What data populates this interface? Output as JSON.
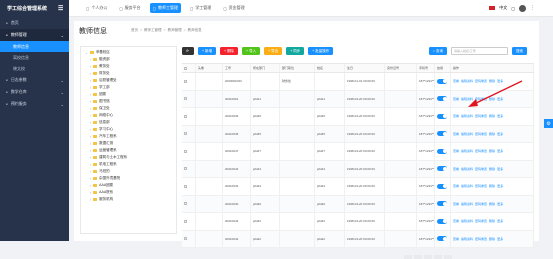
{
  "app": {
    "title": "学工综合管理系统"
  },
  "sidebar": {
    "items": [
      {
        "label": "首页",
        "icon": "home-icon"
      },
      {
        "label": "教师管理",
        "icon": "users-icon",
        "expanded": true
      },
      {
        "label": "教师信息",
        "sub": true,
        "selected": true
      },
      {
        "label": "离校信息",
        "sub": true
      },
      {
        "label": "晓太校",
        "sub": true
      },
      {
        "label": "日志参数",
        "icon": "calendar-icon"
      },
      {
        "label": "数学仓库",
        "icon": "book-icon"
      },
      {
        "label": "预约服务",
        "icon": "service-icon"
      }
    ]
  },
  "topbar": {
    "tabs": [
      {
        "label": "个人办公",
        "icon": "user-icon"
      },
      {
        "label": "服务平台",
        "icon": "grid-icon"
      },
      {
        "label": "教师工管理",
        "icon": "monitor-icon",
        "active": true
      },
      {
        "label": "学工管理",
        "icon": "flag-icon"
      },
      {
        "label": "资金管理",
        "icon": "money-icon"
      }
    ],
    "lang": "中文"
  },
  "page": {
    "title": "教师信息",
    "crumbs": [
      "首页",
      "教师工管理",
      "教师管理",
      "教师信息"
    ]
  },
  "tree": {
    "root": "苹基校区",
    "children": [
      "融资部",
      "教务处",
      "财务处",
      "后勤管理处",
      "学工部",
      "团委",
      "图书馆",
      "保卫处",
      "网络中心",
      "信息部",
      "学习中心",
      "汽车工程系",
      "数据汇测",
      "运营管理系",
      "建筑与土木工程系",
      "机电工程系",
      "马班的",
      "杂国外境基院",
      "AAA团委",
      "AAA院系",
      "服务机构"
    ]
  },
  "toolbar": {
    "buttons": [
      {
        "label": "",
        "icon": "refresh-icon",
        "color": "#333"
      },
      {
        "label": "新增",
        "color": "#1890ff"
      },
      {
        "label": "删除",
        "color": "#f5222d"
      },
      {
        "label": "导入",
        "color": "#52c41a"
      },
      {
        "label": "导出",
        "color": "#faad14"
      },
      {
        "label": "同步",
        "color": "#13a89e"
      },
      {
        "label": "批量操作",
        "color": "#1890ff"
      }
    ],
    "search_btn": "查询",
    "search_placeholder": "请输入姓名/工号",
    "search_submit": "搜索"
  },
  "table": {
    "columns": [
      "",
      "头像",
      "工号",
      "所在部门",
      "部门职位",
      "姓名",
      "生日",
      "身份证号",
      "手机号",
      "启用",
      "操作"
    ],
    "rows": [
      {
        "avatar": "",
        "id": "2020001093",
        "dept": "",
        "pos": "财务处",
        "name": "",
        "birthday": "1998-01-01 00:00:00",
        "idno": "",
        "phone": "187*1234****"
      },
      {
        "avatar": "",
        "id": "20210001",
        "dept": "jsfd41",
        "pos": "",
        "name": "jsfd41",
        "birthday": "1998-03-20 00:00:00",
        "idno": "",
        "phone": "187*1234****"
      },
      {
        "avatar": "",
        "id": "20210046",
        "dept": "jsfd46",
        "pos": "",
        "name": "jsfd46",
        "birthday": "1998-03-20 00:00:00",
        "idno": "",
        "phone": "187*1234****"
      },
      {
        "avatar": "",
        "id": "20210045",
        "dept": "jsfd45",
        "pos": "",
        "name": "jsfd45",
        "birthday": "1998-03-20 00:00:00",
        "idno": "",
        "phone": "187*1234****"
      },
      {
        "avatar": "",
        "id": "20210047",
        "dept": "jsfd47",
        "pos": "",
        "name": "jsfd47",
        "birthday": "1998-03-20 00:00:00",
        "idno": "",
        "phone": "187*1234****"
      },
      {
        "avatar": "",
        "id": "20210044",
        "dept": "jsfd44",
        "pos": "",
        "name": "jsfd44",
        "birthday": "1998-03-20 00:00:00",
        "idno": "",
        "phone": "187*1234****"
      },
      {
        "avatar": "",
        "id": "20210043",
        "dept": "jsfd43",
        "pos": "",
        "name": "jsfd43",
        "birthday": "1998-03-20 00:00:00",
        "idno": "",
        "phone": "187*1234****"
      },
      {
        "avatar": "",
        "id": "20210040",
        "dept": "jsfd40",
        "pos": "",
        "name": "jsfd40",
        "birthday": "1998-03-20 00:00:00",
        "idno": "",
        "phone": "187*1234****"
      },
      {
        "avatar": "",
        "id": "20210042",
        "dept": "jsfd42",
        "pos": "",
        "name": "jsfd42",
        "birthday": "1998-03-20 00:00:00",
        "idno": "",
        "phone": "187*1234****"
      },
      {
        "avatar": "",
        "id": "20210042",
        "dept": "jsfd42",
        "pos": "",
        "name": "jsfd42",
        "birthday": "1998-03-20 00:00:00",
        "idno": "",
        "phone": "187*1234****"
      }
    ],
    "ops": [
      "查看",
      "编辑资料",
      "密码重置",
      "删除",
      "更多"
    ]
  }
}
